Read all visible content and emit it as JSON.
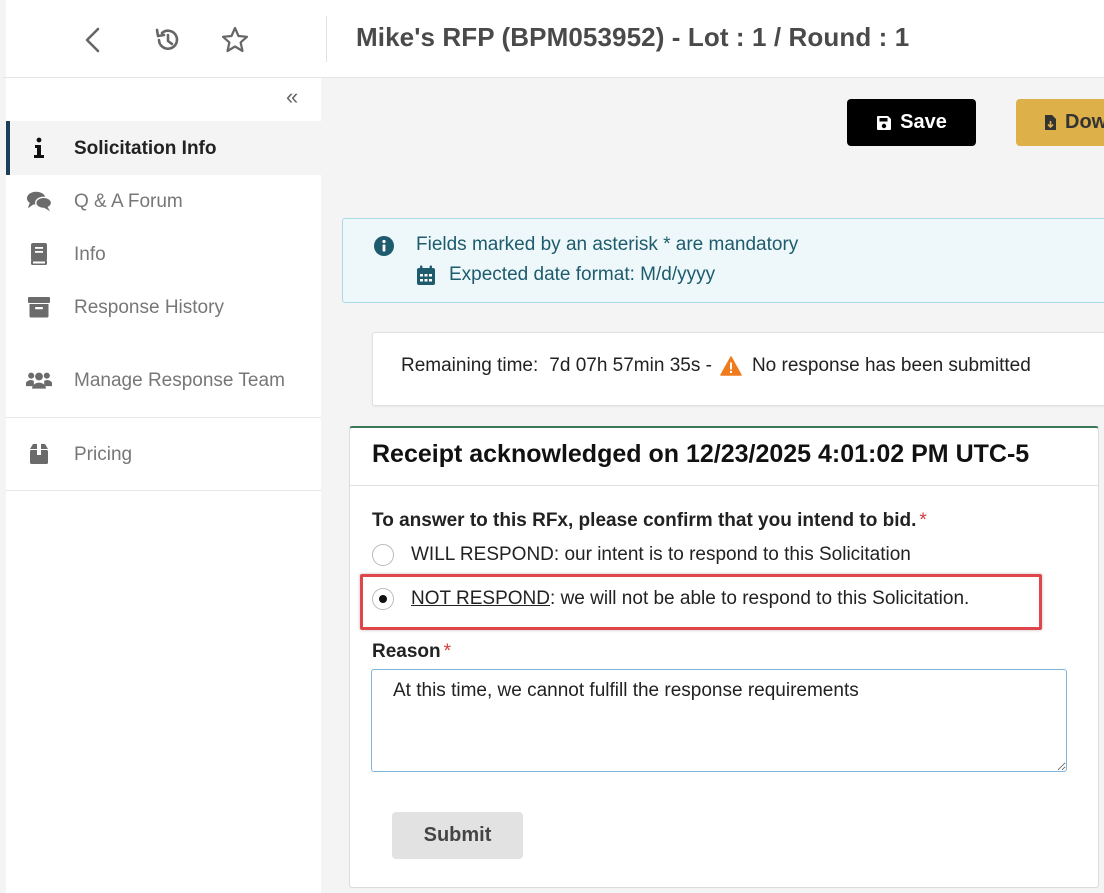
{
  "header": {
    "title": "Mike's RFP (BPM053952) - Lot : 1 / Round : 1",
    "back_icon": "chevron-left-icon",
    "history_icon": "history-icon",
    "favorite_icon": "star-outline-icon"
  },
  "sidebar": {
    "collapse_glyph": "«",
    "items": [
      {
        "label": "Solicitation Info",
        "icon": "info-icon",
        "active": true
      },
      {
        "label": "Q & A Forum",
        "icon": "comments-icon"
      },
      {
        "label": "Info",
        "icon": "book-icon"
      },
      {
        "label": "Response History",
        "icon": "archive-icon"
      },
      {
        "label": "Manage Response Team",
        "icon": "users-icon"
      },
      {
        "label": "Pricing",
        "icon": "box-icon"
      }
    ]
  },
  "toolbar": {
    "save_label": "Save",
    "download_label": "Dow"
  },
  "info_box": {
    "mandatory_text": "Fields marked by an asterisk * are mandatory",
    "date_format_text": "Expected date format: M/d/yyyy"
  },
  "time_box": {
    "label": "Remaining time:",
    "value": "7d 07h 57min 35s -",
    "status": "No response has been submitted"
  },
  "card": {
    "title": "Receipt acknowledged on 12/23/2025 4:01:02 PM UTC-5",
    "question": "To answer to this RFx, please confirm that you intend to bid.",
    "required_mark": "*",
    "option_will_strong": "WILL RESPOND",
    "option_will_rest": ": our intent is to respond to this Solicitation",
    "option_not_strong": "NOT RESPOND",
    "option_not_rest": ": we will not be able to respond to this Solicitation.",
    "selected_option": "NOT RESPOND",
    "reason_label": "Reason",
    "reason_value": "At this time, we cannot fulfill the response requirements",
    "submit_label": "Submit"
  },
  "colors": {
    "active_nav_border": "#1c3f5e",
    "save_bg": "#000000",
    "download_bg": "#ddb04a",
    "info_bg": "#eef8fa",
    "info_text": "#1d5b6d",
    "warning": "#f07b1c",
    "required": "#d63b3b",
    "highlight": "#e0454c"
  }
}
